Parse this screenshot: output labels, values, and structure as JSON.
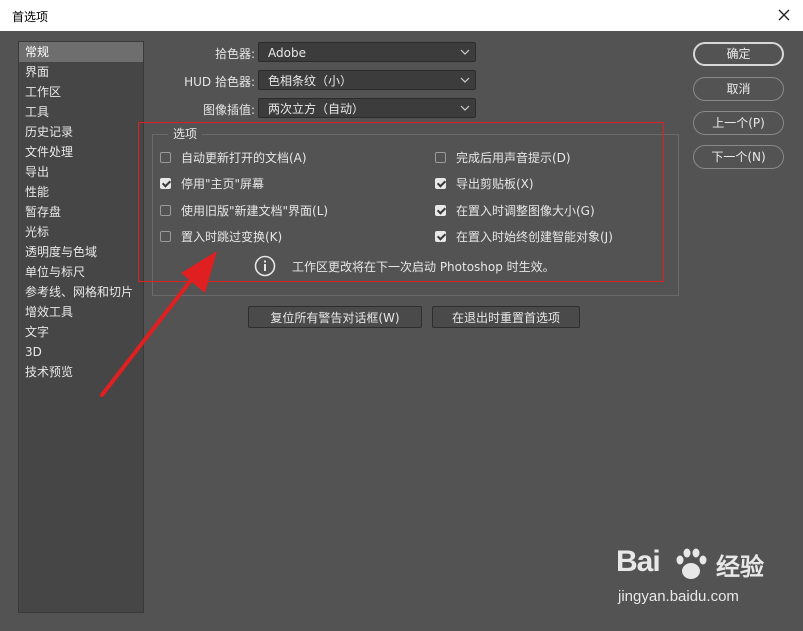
{
  "window": {
    "title": "首选项"
  },
  "sidebar": {
    "items": [
      {
        "label": "常规"
      },
      {
        "label": "界面"
      },
      {
        "label": "工作区"
      },
      {
        "label": "工具"
      },
      {
        "label": "历史记录"
      },
      {
        "label": "文件处理"
      },
      {
        "label": "导出"
      },
      {
        "label": "性能"
      },
      {
        "label": "暂存盘"
      },
      {
        "label": "光标"
      },
      {
        "label": "透明度与色域"
      },
      {
        "label": "单位与标尺"
      },
      {
        "label": "参考线、网格和切片"
      },
      {
        "label": "增效工具"
      },
      {
        "label": "文字"
      },
      {
        "label": "3D"
      },
      {
        "label": "技术预览"
      }
    ],
    "active_index": 0
  },
  "settings": {
    "color_picker": {
      "label": "拾色器:",
      "value": "Adobe"
    },
    "hud_color_picker": {
      "label": "HUD 拾色器:",
      "value": "色相条纹（小）"
    },
    "interpolation": {
      "label": "图像插值:",
      "value": "两次立方（自动）"
    }
  },
  "options": {
    "legend": "选项",
    "left": [
      {
        "label": "自动更新打开的文档(A)",
        "checked": false
      },
      {
        "label": "停用\"主页\"屏幕",
        "checked": true
      },
      {
        "label": "使用旧版\"新建文档\"界面(L)",
        "checked": false
      },
      {
        "label": "置入时跳过变换(K)",
        "checked": false
      }
    ],
    "right": [
      {
        "label": "完成后用声音提示(D)",
        "checked": false
      },
      {
        "label": "导出剪贴板(X)",
        "checked": true
      },
      {
        "label": "在置入时调整图像大小(G)",
        "checked": true
      },
      {
        "label": "在置入时始终创建智能对象(J)",
        "checked": true
      }
    ],
    "info": "工作区更改将在下一次启动 Photoshop 时生效。"
  },
  "buttons": {
    "reset_warnings": "复位所有警告对话框(W)",
    "reset_prefs": "在退出时重置首选项"
  },
  "side_buttons": {
    "ok": "确定",
    "cancel": "取消",
    "prev": "上一个(P)",
    "next": "下一个(N)"
  },
  "watermark": {
    "logo": "Bai",
    "logo_suffix": "经验",
    "url": "jingyan.baidu.com"
  },
  "colors": {
    "background": "#535353",
    "highlight_box": "#e02020",
    "titlebar": "#ffffff"
  }
}
